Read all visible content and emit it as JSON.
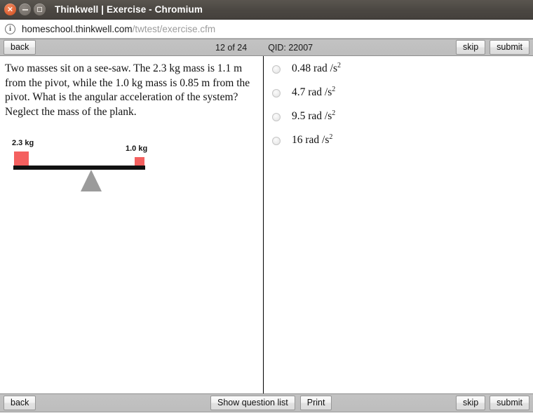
{
  "window": {
    "title": "Thinkwell | Exercise - Chromium",
    "controls": [
      {
        "name": "close",
        "glyph": "×"
      },
      {
        "name": "minimize",
        "glyph": ""
      },
      {
        "name": "maximize",
        "glyph": ""
      }
    ]
  },
  "urlbar": {
    "info_icon": "ⓘ",
    "domain": "homeschool.thinkwell.com",
    "path": "/twtest/exercise.cfm"
  },
  "toolbar_top": {
    "back_label": "back",
    "progress": "12 of 24",
    "qid": "QID: 22007",
    "skip_label": "skip",
    "submit_label": "submit"
  },
  "toolbar_bottom": {
    "back_label": "back",
    "show_question_list_label": "Show question list",
    "print_label": "Print",
    "skip_label": "skip",
    "submit_label": "submit"
  },
  "question": {
    "text": "Two masses sit on a see-saw. The 2.3 kg mass is 1.1 m from the pivot, while the 1.0 kg mass is 0.85 m from the pivot. What is the angular acceleration of the system? Neglect the mass of the plank.",
    "figure": {
      "left_mass_label": "2.3 kg",
      "right_mass_label": "1.0 kg",
      "mass_color": "#f4605f",
      "plank_color": "#111111",
      "pivot_color": "#9b9b9b"
    }
  },
  "answers": {
    "options": [
      {
        "value": "0.48",
        "unit": "rad /s",
        "exponent": "2",
        "selected": false
      },
      {
        "value": "4.7",
        "unit": "rad /s",
        "exponent": "2",
        "selected": false
      },
      {
        "value": "9.5",
        "unit": "rad /s",
        "exponent": "2",
        "selected": false
      },
      {
        "value": "16",
        "unit": "rad /s",
        "exponent": "2",
        "selected": false
      }
    ]
  },
  "colors": {
    "titlebar": "#4b4742",
    "toolbar": "#c0c0c0",
    "accent_red": "#f4605f",
    "pivot_gray": "#9b9b9b"
  }
}
